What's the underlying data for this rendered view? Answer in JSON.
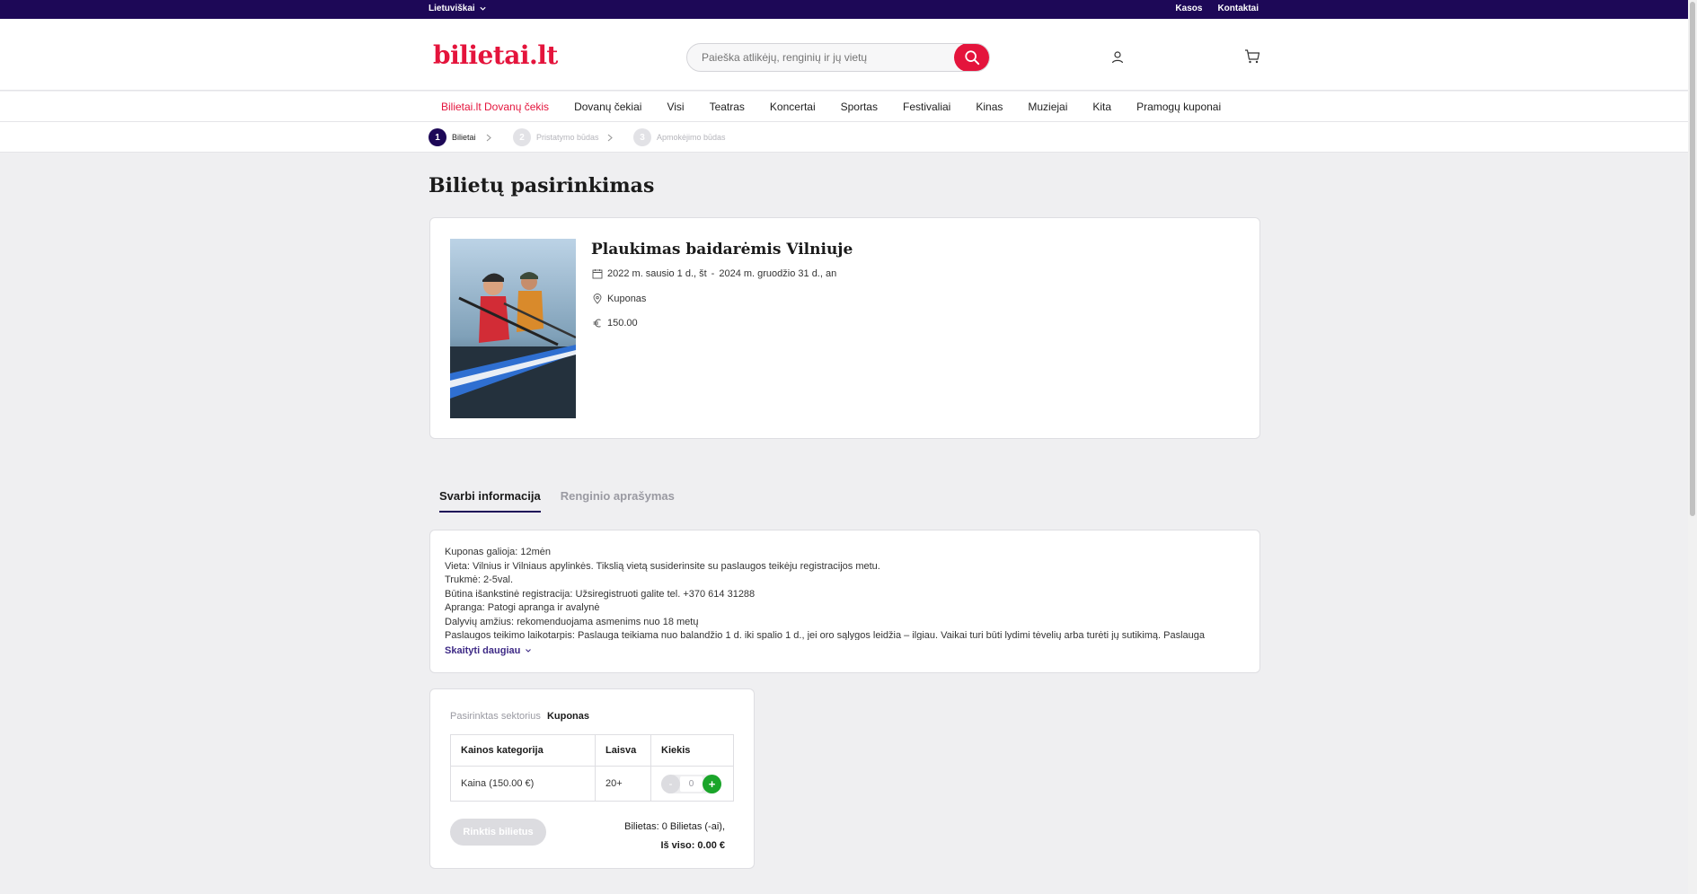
{
  "topbar": {
    "language": "Lietuviškai",
    "links": [
      "Kasos",
      "Kontaktai"
    ]
  },
  "header": {
    "logo_text": "bilietai",
    "logo_dot": ".",
    "logo_tld": "lt",
    "search_placeholder": "Paieška atlikėjų, renginių ir jų vietų"
  },
  "nav": {
    "items": [
      "Bilietai.lt Dovanų čekis",
      "Dovanų čekiai",
      "Visi",
      "Teatras",
      "Koncertai",
      "Sportas",
      "Festivaliai",
      "Kinas",
      "Muziejai",
      "Kita",
      "Pramogų kuponai"
    ]
  },
  "steps": [
    {
      "num": "1",
      "label": "Bilietai"
    },
    {
      "num": "2",
      "label": "Pristatymo būdas"
    },
    {
      "num": "3",
      "label": "Apmokėjimo būdas"
    }
  ],
  "page_title": "Bilietų pasirinkimas",
  "event": {
    "title": "Plaukimas baidarėmis Vilniuje",
    "date_start": "2022 m. sausio 1 d., št",
    "date_sep": "-",
    "date_end": "2024 m. gruodžio 31 d., an",
    "venue": "Kuponas",
    "price": "150.00"
  },
  "tabs": [
    "Svarbi informacija",
    "Renginio aprašymas"
  ],
  "info": {
    "lines": [
      "Kuponas galioja: 12mėn",
      "Vieta:  Vilnius ir Vilniaus apylinkės. Tikslią vietą susiderinsite su paslaugos teikėju registracijos metu.",
      "Trukmė: 2-5val.",
      "Būtina išankstinė registracija: Užsiregistruoti galite tel. +370 614 31288",
      "Apranga: Patogi apranga ir avalynė",
      "Dalyvių amžius: rekomenduojama asmenims nuo 18 metų",
      "Paslaugos teikimo laikotarpis: Paslauga teikiama nuo balandžio 1 d. iki spalio 1 d., jei oro sąlygos leidžia – ilgiau. Vaikai turi būti lydimi tėvelių arba turėti jų sutikimą. Paslauga"
    ],
    "read_more": "Skaityti daugiau"
  },
  "tickets": {
    "sector_label": "Pasirinktas sektorius",
    "sector_value": "Kuponas",
    "headers": [
      "Kainos kategorija",
      "Laisva",
      "Kiekis"
    ],
    "rows": [
      {
        "category": "Kaina (150.00 €)",
        "available": "20+",
        "qty": "0"
      }
    ],
    "minus": "-",
    "plus": "+",
    "button": "Rinktis bilietus",
    "summary_line": "Bilietas: 0 Bilietas (-ai),",
    "total_line": "Iš viso: 0.00 €"
  },
  "colors": {
    "brand_red": "#e4143c",
    "brand_navy": "#1d0857",
    "plus_green": "#1aa52a"
  }
}
